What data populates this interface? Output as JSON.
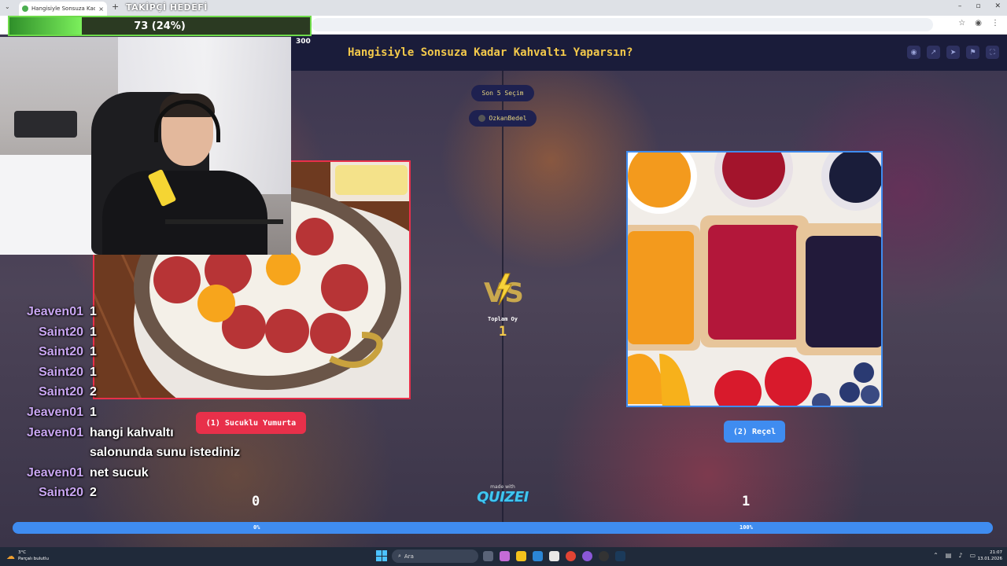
{
  "browser": {
    "tab_title": "Hangisiyle Sonsuza Kadar Kahv...",
    "tab_close": "×",
    "new_tab": "+",
    "window_controls": [
      "–",
      "▫",
      "✕"
    ]
  },
  "follower_goal": {
    "label": "TAKİPÇİ HEDEFİ",
    "progress_text": "73 (24%)",
    "progress": 0.24,
    "max": "300"
  },
  "quiz": {
    "title": "Hangisiyle Sonsuza Kadar Kahvaltı Yaparsın?",
    "header_icons": [
      "eye-icon",
      "external-link-icon",
      "send-icon",
      "flag-icon",
      "fullscreen-icon"
    ],
    "last_picks_label": "Son 5 Seçim",
    "last_voter": "OzkanBedel",
    "total_votes_label": "Toplam Oy",
    "total_votes": "1",
    "option_left": {
      "label": "(1) Sucuklu Yumurta",
      "score": "0",
      "percent_label": "0%"
    },
    "option_right": {
      "label": "(2) Reçel",
      "score": "1",
      "percent_label": "100%"
    },
    "right_share": 1.0,
    "made_with": "made with",
    "brand": "QUIZEI",
    "colors": {
      "left": "#e8304a",
      "right": "#3f8cf0",
      "title": "#f3c94b",
      "header_bg": "#1a1c3a"
    }
  },
  "chat": [
    {
      "user": "Jeaven01",
      "msg": "1"
    },
    {
      "user": "Saint20",
      "msg": "1"
    },
    {
      "user": "Saint20",
      "msg": "1"
    },
    {
      "user": "Saint20",
      "msg": "1"
    },
    {
      "user": "Saint20",
      "msg": "2"
    },
    {
      "user": "Jeaven01",
      "msg": "1"
    },
    {
      "user": "Jeaven01",
      "msg": "hangi kahvaltı"
    },
    {
      "user": "",
      "msg": "salonunda sunu istediniz"
    },
    {
      "user": "Jeaven01",
      "msg": "net sucuk"
    },
    {
      "user": "Saint20",
      "msg": "2"
    }
  ],
  "taskbar": {
    "weather_temp": "3°C",
    "weather_desc": "Parçalı bulutlu",
    "search_placeholder": "Ara",
    "time": "21:07",
    "date": "13.01.2026"
  }
}
